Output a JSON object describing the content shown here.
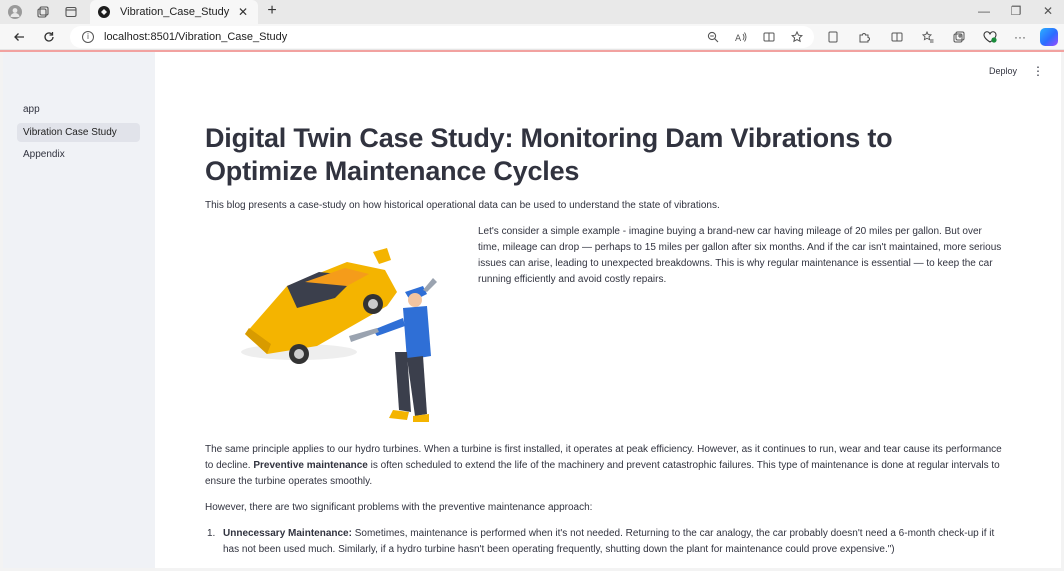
{
  "browser": {
    "tab_title": "Vibration_Case_Study",
    "url": "localhost:8501/Vibration_Case_Study"
  },
  "sidebar": {
    "items": [
      {
        "label": "app",
        "active": false
      },
      {
        "label": "Vibration Case Study",
        "active": true
      },
      {
        "label": "Appendix",
        "active": false
      }
    ]
  },
  "toolbar": {
    "deploy_label": "Deploy"
  },
  "main": {
    "title": "Digital Twin Case Study: Monitoring Dam Vibrations to Optimize Maintenance Cycles",
    "intro": "This blog presents a case-study on how historical operational data can be used to understand the state of vibrations.",
    "car_example": "Let's consider a simple example - imagine buying a brand-new car having mileage of 20 miles per gallon. But over time, mileage can drop — perhaps to 15 miles per gallon after six months. And if the car isn't maintained, more serious issues can arise, leading to unexpected breakdowns. This is why regular maintenance is essential — to keep the car running efficiently and avoid costly repairs.",
    "principle_1": "The same principle applies to our hydro turbines. When a turbine is first installed, it operates at peak efficiency. However, as it continues to run, wear and tear cause its performance to decline.",
    "principle_bold": "Preventive maintenance",
    "principle_2": " is often scheduled to extend the life of the machinery and prevent catastrophic failures. This type of maintenance is done at regular intervals to ensure the turbine operates smoothly.",
    "problems_intro": "However, there are two significant problems with the preventive maintenance approach:",
    "list": [
      {
        "number": "1.",
        "bold": "Unnecessary Maintenance:",
        "text": " Sometimes, maintenance is performed when it's not needed. Returning to the car analogy, the car probably doesn't need a 6-month check-up if it has not been used much. Similarly, if a hydro turbine hasn't been operating frequently, shutting down the plant for maintenance could prove expensive.\")"
      }
    ]
  },
  "colors": {
    "accent_red": "#f2a2a0",
    "sidebar_bg": "#f0f2f6",
    "text": "#31333f"
  }
}
